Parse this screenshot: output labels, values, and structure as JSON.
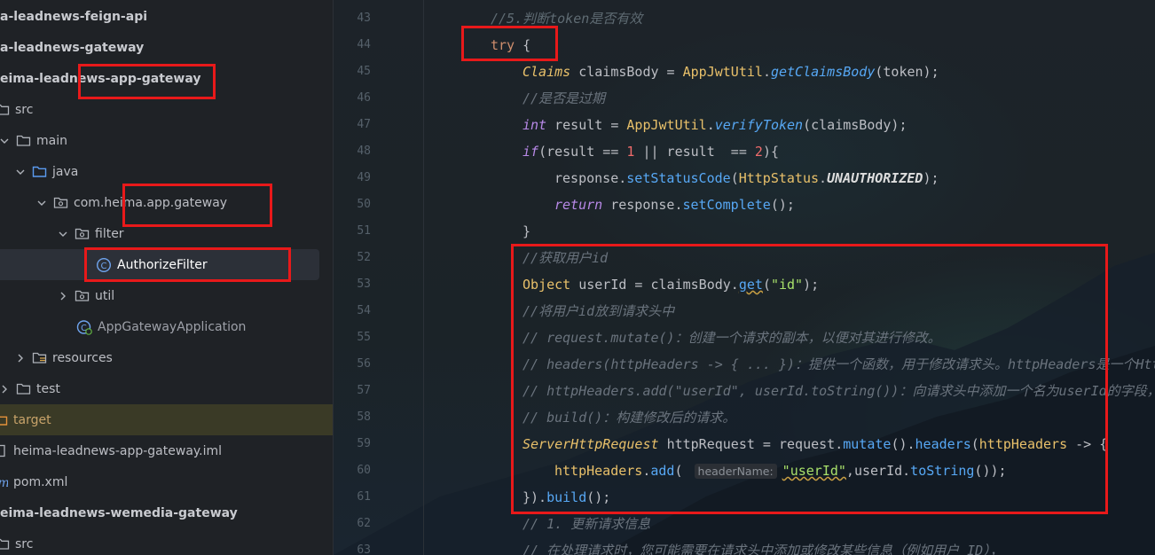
{
  "project_tree": {
    "items": [
      {
        "label": "a-leadnews-feign-api",
        "icon": "module-icon",
        "bold": true
      },
      {
        "label": "a-leadnews-gateway",
        "icon": "module-icon",
        "bold": true
      },
      {
        "label": "eima-leadnews-app-gateway",
        "icon": "module-icon",
        "bold": true
      },
      {
        "label": "src",
        "icon": "folder-icon"
      },
      {
        "label": "main",
        "icon": "folder-icon"
      },
      {
        "label": "java",
        "icon": "source-folder-icon"
      },
      {
        "label": "com.heima.app.gateway",
        "icon": "package-icon"
      },
      {
        "label": "filter",
        "icon": "package-icon"
      },
      {
        "label": "AuthorizeFilter",
        "icon": "class-icon",
        "selected": true
      },
      {
        "label": "util",
        "icon": "package-icon"
      },
      {
        "label": "AppGatewayApplication",
        "icon": "spring-app-icon"
      },
      {
        "label": "resources",
        "icon": "resources-folder-icon"
      },
      {
        "label": "test",
        "icon": "folder-icon"
      },
      {
        "label": "target",
        "icon": "excluded-folder-icon",
        "excluded": true
      },
      {
        "label": "heima-leadnews-app-gateway.iml",
        "icon": "iml-file-icon"
      },
      {
        "label": "pom.xml",
        "icon": "maven-icon"
      },
      {
        "label": "eima-leadnews-wemedia-gateway",
        "icon": "module-icon",
        "bold": true
      },
      {
        "label": "src",
        "icon": "folder-icon"
      }
    ]
  },
  "editor": {
    "lines": [
      {
        "num": "43",
        "tokens": [
          [
            "cmd",
            "//5.判断token是否有效"
          ]
        ]
      },
      {
        "num": "44",
        "tokens": [
          [
            "k",
            "try "
          ],
          [
            "p",
            "{"
          ]
        ]
      },
      {
        "num": "45",
        "tokens": [
          [
            "ty",
            "Claims "
          ],
          [
            "p",
            "claimsBody = "
          ],
          [
            "tyn",
            "AppJwtUtil"
          ],
          [
            "p",
            "."
          ],
          [
            "mti",
            "getClaimsBody"
          ],
          [
            "p",
            "(token);"
          ]
        ]
      },
      {
        "num": "46",
        "tokens": [
          [
            "cm",
            "//是否是过期"
          ]
        ]
      },
      {
        "num": "47",
        "tokens": [
          [
            "kw",
            "int "
          ],
          [
            "p",
            "result = "
          ],
          [
            "tyn",
            "AppJwtUtil"
          ],
          [
            "p",
            "."
          ],
          [
            "mti",
            "verifyToken"
          ],
          [
            "p",
            "(claimsBody);"
          ]
        ]
      },
      {
        "num": "48",
        "tokens": [
          [
            "kw",
            "if"
          ],
          [
            "p",
            "(result == "
          ],
          [
            "num",
            "1"
          ],
          [
            "p",
            " || result  == "
          ],
          [
            "num",
            "2"
          ],
          [
            "p",
            "){"
          ]
        ]
      },
      {
        "num": "49",
        "tokens": [
          [
            "p",
            "response."
          ],
          [
            "mt",
            "setStatusCode"
          ],
          [
            "p",
            "("
          ],
          [
            "tyn",
            "HttpStatus"
          ],
          [
            "p",
            "."
          ],
          [
            "cst",
            "UNAUTHORIZED"
          ],
          [
            "p",
            ");"
          ]
        ]
      },
      {
        "num": "50",
        "tokens": [
          [
            "kw",
            "return "
          ],
          [
            "p",
            "response."
          ],
          [
            "mt",
            "setComplete"
          ],
          [
            "p",
            "();"
          ]
        ]
      },
      {
        "num": "51",
        "tokens": [
          [
            "p",
            "}"
          ]
        ]
      },
      {
        "num": "52",
        "tokens": [
          [
            "cm",
            "//获取用户id"
          ]
        ]
      },
      {
        "num": "53",
        "tokens": [
          [
            "tyn",
            "Object "
          ],
          [
            "p",
            "userId = claimsBody."
          ],
          [
            "mtu",
            "get"
          ],
          [
            "p",
            "("
          ],
          [
            "str",
            "\"id\""
          ],
          [
            "p",
            ");"
          ]
        ]
      },
      {
        "num": "54",
        "tokens": [
          [
            "cm",
            "//将用户id放到请求头中"
          ]
        ]
      },
      {
        "num": "55",
        "tokens": [
          [
            "cm",
            "// request.mutate()：创建一个请求的副本，以便对其进行修改。"
          ]
        ]
      },
      {
        "num": "56",
        "tokens": [
          [
            "cm",
            "// headers(httpHeaders -> { ... })：提供一个函数，用于修改请求头。httpHeaders是一个HttpHeaders对象"
          ]
        ]
      },
      {
        "num": "57",
        "tokens": [
          [
            "cm",
            "// httpHeaders.add(\"userId\", userId.toString())：向请求头中添加一个名为userId的字段，其值为"
          ]
        ]
      },
      {
        "num": "58",
        "tokens": [
          [
            "cm",
            "// build()：构建修改后的请求。"
          ]
        ]
      },
      {
        "num": "59",
        "tokens": [
          [
            "ty",
            "ServerHttpRequest "
          ],
          [
            "p",
            "httpRequest = request."
          ],
          [
            "mt",
            "mutate"
          ],
          [
            "p",
            "()."
          ],
          [
            "mt",
            "headers"
          ],
          [
            "p",
            "("
          ],
          [
            "lam",
            "httpHeaders"
          ],
          [
            "p",
            " -> {"
          ]
        ]
      },
      {
        "num": "60",
        "tokens": [
          [
            "lam",
            "httpHeaders"
          ],
          [
            "p",
            "."
          ],
          [
            "mt",
            "add"
          ],
          [
            "p",
            "( "
          ],
          [
            "hint",
            "headerName:"
          ],
          [
            "stru",
            "\"userId\""
          ],
          [
            "p",
            ",userId."
          ],
          [
            "mt",
            "toString"
          ],
          [
            "p",
            "());"
          ]
        ]
      },
      {
        "num": "61",
        "tokens": [
          [
            "p",
            "})."
          ],
          [
            "mt",
            "build"
          ],
          [
            "p",
            "();"
          ]
        ]
      },
      {
        "num": "62",
        "tokens": [
          [
            "cm",
            "// 1. 更新请求信息"
          ]
        ]
      },
      {
        "num": "63",
        "tokens": [
          [
            "cm",
            "// 在处理请求时，您可能需要在请求头中添加或修改某些信息（例如用户 ID），"
          ]
        ]
      }
    ]
  }
}
